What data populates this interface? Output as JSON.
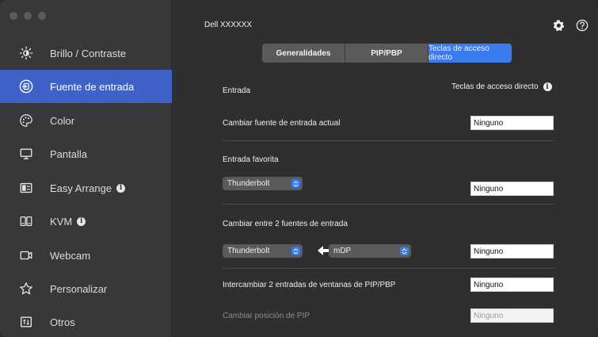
{
  "window": {
    "title": "Dell XXXXXX"
  },
  "sidebar": {
    "items": [
      {
        "label": "Brillo / Contraste",
        "icon": "brightness-icon"
      },
      {
        "label": "Fuente de entrada",
        "icon": "input-source-icon"
      },
      {
        "label": "Color",
        "icon": "color-palette-icon"
      },
      {
        "label": "Pantalla",
        "icon": "monitor-icon"
      },
      {
        "label": "Easy Arrange",
        "icon": "layout-icon"
      },
      {
        "label": "KVM",
        "icon": "kvm-icon"
      },
      {
        "label": "Webcam",
        "icon": "webcam-icon"
      },
      {
        "label": "Personalizar",
        "icon": "star-icon"
      },
      {
        "label": "Otros",
        "icon": "others-icon"
      }
    ],
    "active_index": 1,
    "accent": "#3f62c9"
  },
  "tabs": [
    {
      "label": "Generalidades"
    },
    {
      "label": "PIP/PBP"
    },
    {
      "label": "Teclas de acceso directo"
    }
  ],
  "header": {
    "left": "Entrada",
    "right": "Teclas de acceso directo"
  },
  "rows": {
    "change_current": {
      "label": "Cambiar fuente de entrada actual",
      "hotkey": "Ninguno"
    },
    "favorite": {
      "label": "Entrada favorita",
      "select": "Thunderbolt",
      "hotkey": "Ninguno"
    },
    "switch_two": {
      "label": "Cambiar entre 2 fuentes de entrada",
      "select_a": "Thunderbolt",
      "select_b": "mDP",
      "hotkey": "Ninguno"
    },
    "swap_pip": {
      "label": "Intercambiar 2 entradas de ventanas de PIP/PBP",
      "hotkey": "Ninguno"
    },
    "pip_position": {
      "label": "Cambiar posición de PIP",
      "hotkey": "Ninguno"
    }
  },
  "colors": {
    "tab_active": "#3a7bf0",
    "background": "#2f2f31"
  }
}
